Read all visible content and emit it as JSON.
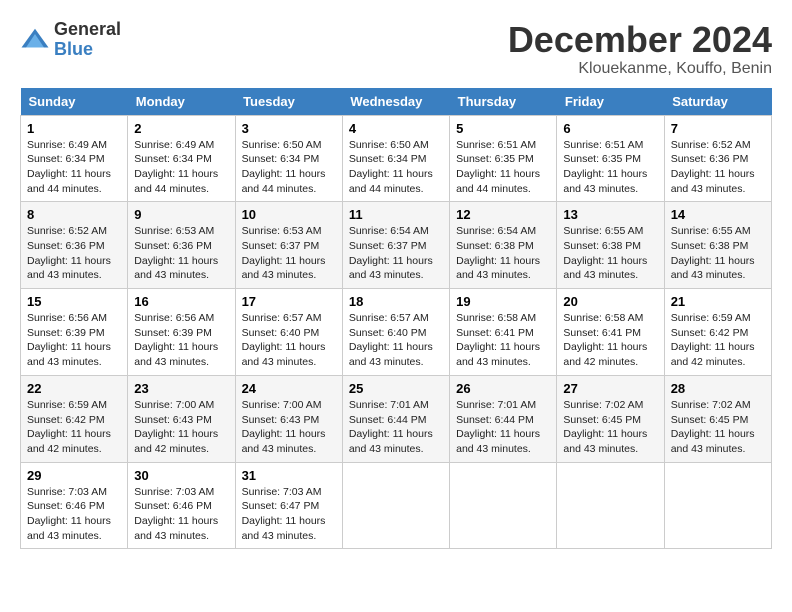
{
  "header": {
    "logo": {
      "general": "General",
      "blue": "Blue"
    },
    "title": "December 2024",
    "location": "Klouekanme, Kouffo, Benin"
  },
  "calendar": {
    "days_of_week": [
      "Sunday",
      "Monday",
      "Tuesday",
      "Wednesday",
      "Thursday",
      "Friday",
      "Saturday"
    ],
    "weeks": [
      [
        {
          "day": "1",
          "sunrise": "6:49 AM",
          "sunset": "6:34 PM",
          "daylight": "11 hours and 44 minutes."
        },
        {
          "day": "2",
          "sunrise": "6:49 AM",
          "sunset": "6:34 PM",
          "daylight": "11 hours and 44 minutes."
        },
        {
          "day": "3",
          "sunrise": "6:50 AM",
          "sunset": "6:34 PM",
          "daylight": "11 hours and 44 minutes."
        },
        {
          "day": "4",
          "sunrise": "6:50 AM",
          "sunset": "6:34 PM",
          "daylight": "11 hours and 44 minutes."
        },
        {
          "day": "5",
          "sunrise": "6:51 AM",
          "sunset": "6:35 PM",
          "daylight": "11 hours and 44 minutes."
        },
        {
          "day": "6",
          "sunrise": "6:51 AM",
          "sunset": "6:35 PM",
          "daylight": "11 hours and 43 minutes."
        },
        {
          "day": "7",
          "sunrise": "6:52 AM",
          "sunset": "6:36 PM",
          "daylight": "11 hours and 43 minutes."
        }
      ],
      [
        {
          "day": "8",
          "sunrise": "6:52 AM",
          "sunset": "6:36 PM",
          "daylight": "11 hours and 43 minutes."
        },
        {
          "day": "9",
          "sunrise": "6:53 AM",
          "sunset": "6:36 PM",
          "daylight": "11 hours and 43 minutes."
        },
        {
          "day": "10",
          "sunrise": "6:53 AM",
          "sunset": "6:37 PM",
          "daylight": "11 hours and 43 minutes."
        },
        {
          "day": "11",
          "sunrise": "6:54 AM",
          "sunset": "6:37 PM",
          "daylight": "11 hours and 43 minutes."
        },
        {
          "day": "12",
          "sunrise": "6:54 AM",
          "sunset": "6:38 PM",
          "daylight": "11 hours and 43 minutes."
        },
        {
          "day": "13",
          "sunrise": "6:55 AM",
          "sunset": "6:38 PM",
          "daylight": "11 hours and 43 minutes."
        },
        {
          "day": "14",
          "sunrise": "6:55 AM",
          "sunset": "6:38 PM",
          "daylight": "11 hours and 43 minutes."
        }
      ],
      [
        {
          "day": "15",
          "sunrise": "6:56 AM",
          "sunset": "6:39 PM",
          "daylight": "11 hours and 43 minutes."
        },
        {
          "day": "16",
          "sunrise": "6:56 AM",
          "sunset": "6:39 PM",
          "daylight": "11 hours and 43 minutes."
        },
        {
          "day": "17",
          "sunrise": "6:57 AM",
          "sunset": "6:40 PM",
          "daylight": "11 hours and 43 minutes."
        },
        {
          "day": "18",
          "sunrise": "6:57 AM",
          "sunset": "6:40 PM",
          "daylight": "11 hours and 43 minutes."
        },
        {
          "day": "19",
          "sunrise": "6:58 AM",
          "sunset": "6:41 PM",
          "daylight": "11 hours and 43 minutes."
        },
        {
          "day": "20",
          "sunrise": "6:58 AM",
          "sunset": "6:41 PM",
          "daylight": "11 hours and 42 minutes."
        },
        {
          "day": "21",
          "sunrise": "6:59 AM",
          "sunset": "6:42 PM",
          "daylight": "11 hours and 42 minutes."
        }
      ],
      [
        {
          "day": "22",
          "sunrise": "6:59 AM",
          "sunset": "6:42 PM",
          "daylight": "11 hours and 42 minutes."
        },
        {
          "day": "23",
          "sunrise": "7:00 AM",
          "sunset": "6:43 PM",
          "daylight": "11 hours and 42 minutes."
        },
        {
          "day": "24",
          "sunrise": "7:00 AM",
          "sunset": "6:43 PM",
          "daylight": "11 hours and 43 minutes."
        },
        {
          "day": "25",
          "sunrise": "7:01 AM",
          "sunset": "6:44 PM",
          "daylight": "11 hours and 43 minutes."
        },
        {
          "day": "26",
          "sunrise": "7:01 AM",
          "sunset": "6:44 PM",
          "daylight": "11 hours and 43 minutes."
        },
        {
          "day": "27",
          "sunrise": "7:02 AM",
          "sunset": "6:45 PM",
          "daylight": "11 hours and 43 minutes."
        },
        {
          "day": "28",
          "sunrise": "7:02 AM",
          "sunset": "6:45 PM",
          "daylight": "11 hours and 43 minutes."
        }
      ],
      [
        {
          "day": "29",
          "sunrise": "7:03 AM",
          "sunset": "6:46 PM",
          "daylight": "11 hours and 43 minutes."
        },
        {
          "day": "30",
          "sunrise": "7:03 AM",
          "sunset": "6:46 PM",
          "daylight": "11 hours and 43 minutes."
        },
        {
          "day": "31",
          "sunrise": "7:03 AM",
          "sunset": "6:47 PM",
          "daylight": "11 hours and 43 minutes."
        },
        null,
        null,
        null,
        null
      ]
    ]
  }
}
